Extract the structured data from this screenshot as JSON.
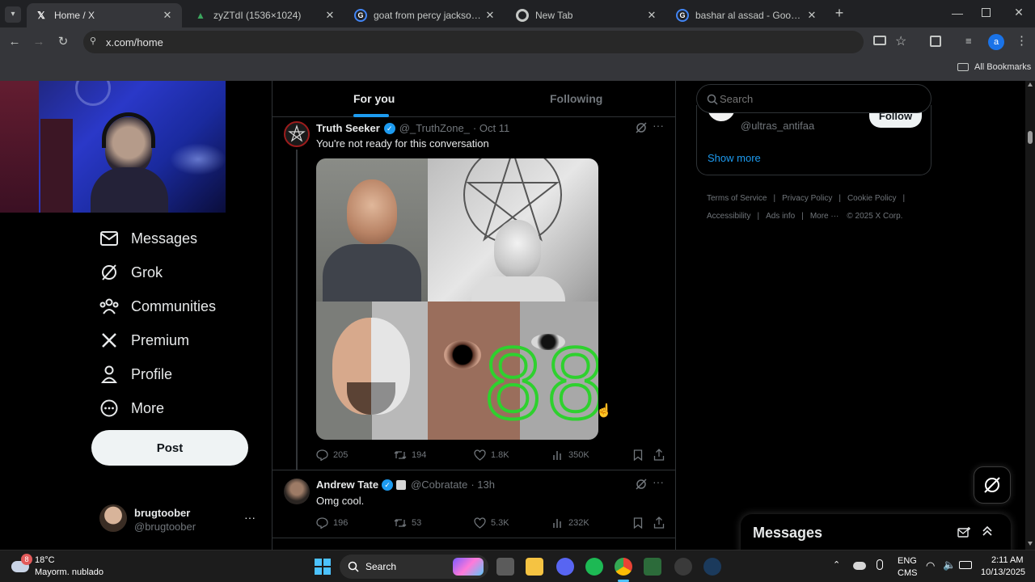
{
  "browser": {
    "tabs": [
      {
        "title": "Home / X",
        "active": true,
        "icon": "x-logo-icon"
      },
      {
        "title": "zyZTdI (1536×1024)",
        "active": false,
        "icon": "image-icon"
      },
      {
        "title": "goat from percy jackson - Goo",
        "active": false,
        "icon": "google-icon"
      },
      {
        "title": "New Tab",
        "active": false,
        "icon": "chrome-icon"
      },
      {
        "title": "bashar al assad - Google Searc",
        "active": false,
        "icon": "google-icon"
      }
    ],
    "url": "x.com/home",
    "bookmarks_label": "All Bookmarks",
    "profile_initial": "a"
  },
  "sidebar": {
    "items": [
      {
        "label": "Messages",
        "icon": "mail-icon"
      },
      {
        "label": "Grok",
        "icon": "grok-icon"
      },
      {
        "label": "Communities",
        "icon": "communities-icon"
      },
      {
        "label": "Premium",
        "icon": "x-premium-icon"
      },
      {
        "label": "Profile",
        "icon": "person-icon"
      },
      {
        "label": "More",
        "icon": "more-circle-icon"
      }
    ],
    "post_label": "Post",
    "account": {
      "name": "brugtoober",
      "handle": "@brugtoober",
      "menu": "···"
    }
  },
  "feed": {
    "tabs": [
      {
        "label": "For you",
        "active": true
      },
      {
        "label": "Following",
        "active": false
      }
    ],
    "tweets": [
      {
        "name": "Truth Seeker",
        "handle": "@_TruthZone_",
        "time": "· Oct 11",
        "text": "You're not ready for this conversation",
        "stats": {
          "replies": "205",
          "reposts": "194",
          "likes": "1.8K",
          "views": "350K"
        },
        "image_overlay": "88"
      },
      {
        "name": "Andrew Tate",
        "handle": "@Cobratate",
        "time": "· 13h",
        "text": "Omg cool.",
        "stats": {
          "replies": "196",
          "reposts": "53",
          "likes": "5.3K",
          "views": "232K"
        }
      }
    ]
  },
  "right": {
    "search_placeholder": "Search",
    "suggestion_handle": "@ultras_antifaa",
    "follow_label": "Follow",
    "show_more": "Show more",
    "footer": [
      "Terms of Service",
      "Privacy Policy",
      "Cookie Policy",
      "Accessibility",
      "Ads info",
      "More ···",
      "© 2025 X Corp."
    ],
    "messages_title": "Messages"
  },
  "taskbar": {
    "weather_temp": "18°C",
    "weather_desc": "Mayorm. nublado",
    "weather_badge": "8",
    "search_label": "Search",
    "lang1": "ENG",
    "lang2": "CMS",
    "time": "2:11 AM",
    "date": "10/13/2025"
  }
}
